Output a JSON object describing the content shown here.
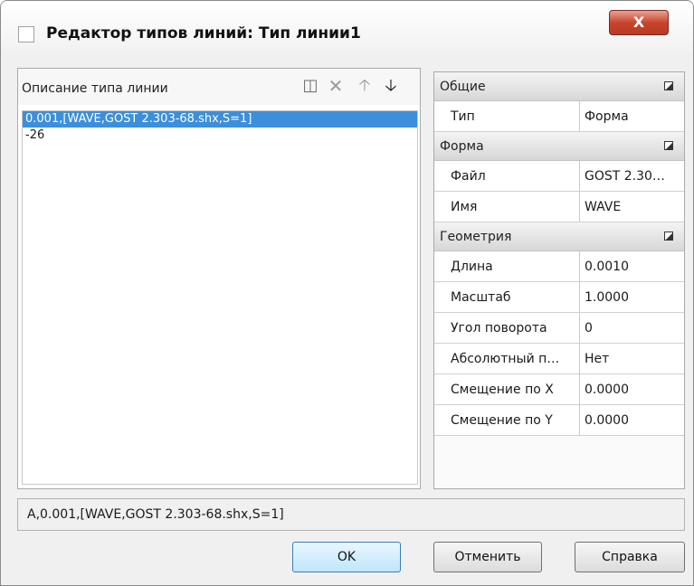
{
  "window": {
    "title": "Редактор типов линий: Тип линии1",
    "close_label": "X"
  },
  "description": {
    "label": "Описание типа линии",
    "lines": [
      "0.001,[WAVE,GOST 2.303-68.shx,S=1]",
      "-26"
    ],
    "selected_line": 0,
    "toolbar_icons": [
      "new-icon",
      "delete-icon",
      "move-up-icon",
      "move-down-icon"
    ]
  },
  "properties": {
    "groups": [
      {
        "label": "Общие",
        "rows": [
          {
            "name": "Тип",
            "value": "Форма"
          }
        ]
      },
      {
        "label": "Форма",
        "rows": [
          {
            "name": "Файл",
            "value": "GOST 2.30…"
          },
          {
            "name": "Имя",
            "value": "WAVE"
          }
        ]
      },
      {
        "label": "Геометрия",
        "rows": [
          {
            "name": "Длина",
            "value": "0.0010"
          },
          {
            "name": "Масштаб",
            "value": "1.0000"
          },
          {
            "name": "Угол поворота",
            "value": "0"
          },
          {
            "name": "Абсолютный п…",
            "value": "Нет"
          },
          {
            "name": "Смещение по X",
            "value": "0.0000"
          },
          {
            "name": "Смещение по Y",
            "value": "0.0000"
          }
        ]
      }
    ]
  },
  "result_string": "A,0.001,[WAVE,GOST 2.303-68.shx,S=1]",
  "buttons": {
    "ok": "OK",
    "cancel": "Отменить",
    "help": "Справка"
  },
  "colors": {
    "selection": "#3b8fdb",
    "close_button": "#c9452c"
  }
}
